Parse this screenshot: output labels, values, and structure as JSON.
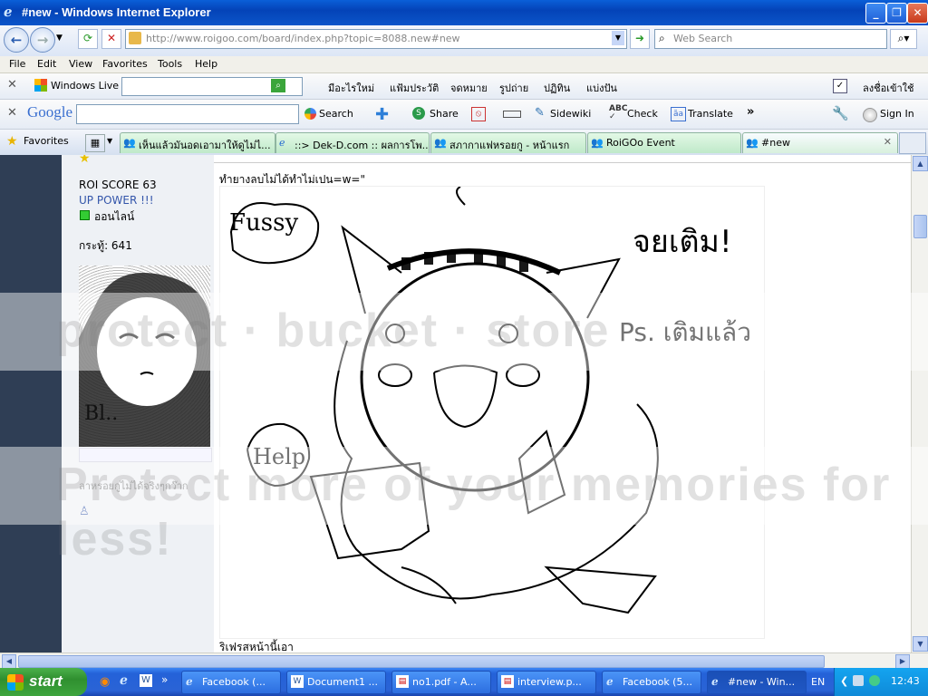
{
  "window": {
    "title": "#new - Windows Internet Explorer"
  },
  "address": {
    "url": "http://www.roigoo.com/board/index.php?topic=8088.new#new",
    "search_placeholder": "Web Search"
  },
  "menu": [
    "File",
    "Edit",
    "View",
    "Favorites",
    "Tools",
    "Help"
  ],
  "live_toolbar": {
    "brand": "Windows Live",
    "items": [
      "มีอะไรใหม่",
      "แฟ้มประวัติ",
      "จดหมาย",
      "รูปถ่าย",
      "ปฏิทิน",
      "แบ่งปัน"
    ],
    "signin": "ลงชื่อเข้าใช้"
  },
  "google_toolbar": {
    "brand": "Google",
    "search": "Search",
    "share": "Share",
    "sidewiki": "Sidewiki",
    "check": "Check",
    "translate": "Translate",
    "signin": "Sign In"
  },
  "tabs": {
    "favorites": "Favorites",
    "items": [
      "เห็นแล้วมันอดเอามาให้ดูไม่ไ...",
      "::> Dek-D.com :: ผลการโพ...",
      "สภากาแฟหรอยกู - หน้าแรก",
      "RoiGOo Event",
      "#new"
    ]
  },
  "sidebar": {
    "score": "ROI SCORE 63",
    "power": "UP POWER !!!",
    "status": "ออนไลน์",
    "posts": "กระทู้: 641",
    "signature": "ลาหรอยกูไม่ได้จริงๆกว๊าก"
  },
  "post": {
    "top_text": "ทำยางลบไม่ได้ทำไม่เปน=w=\"",
    "bottom_text": "ริเฟรสหน้านี้เอา",
    "drawing": {
      "bubble_left": "Fussy",
      "top_right": "จยเติม!",
      "right_note": "Ps. เติมแล้ว",
      "help": "Help"
    }
  },
  "taskbar": {
    "start": "start",
    "items": [
      "Facebook (...",
      "Document1 ...",
      "no1.pdf - A...",
      "interview.p...",
      "Facebook (5...",
      "#new - Win..."
    ],
    "lang": "EN",
    "time": "12:43"
  },
  "colors": {
    "sidebar_dark": "#2f3e55",
    "tab_green": "#bfe9c9",
    "power_blue": "#3355aa"
  }
}
